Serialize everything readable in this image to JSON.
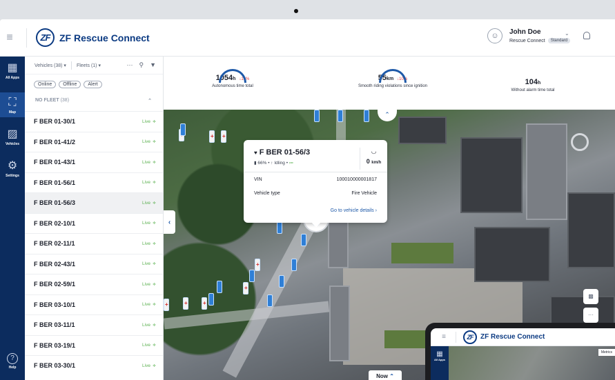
{
  "app": {
    "title": "ZF Rescue Connect",
    "logo_mark": "ZF"
  },
  "user": {
    "name": "John Doe",
    "subscription": "Rescue Connect",
    "plan_badge": "Standard"
  },
  "rail": {
    "items": [
      {
        "label": "All Apps",
        "icon": "grid-icon",
        "glyph": "▦"
      },
      {
        "label": "Map",
        "icon": "map-icon",
        "glyph": "⛶"
      },
      {
        "label": "Vehicles",
        "icon": "car-icon",
        "glyph": "🚘"
      },
      {
        "label": "Settings",
        "icon": "gear-icon",
        "glyph": "⚙"
      }
    ],
    "help_label": "Help",
    "help_glyph": "?"
  },
  "panel": {
    "vehicles_filter": "Vehicles (38) ▾",
    "fleets_filter": "Fleets (1) ▾",
    "status_chips": [
      "Online",
      "Offline",
      "Alert"
    ],
    "fleet_group": "NO FLEET",
    "fleet_count": "(38)",
    "live_label": "Live",
    "vehicles": [
      "F BER 01-30/1",
      "F BER 01-41/2",
      "F BER 01-43/1",
      "F BER 01-56/1",
      "F BER 01-56/3",
      "F BER 02-10/1",
      "F BER 02-11/1",
      "F BER 02-43/1",
      "F BER 02-59/1",
      "F BER 03-10/1",
      "F BER 03-11/1",
      "F BER 03-19/1",
      "F BER 03-30/1"
    ],
    "selected_index": 4
  },
  "metrics": [
    {
      "value": "1054",
      "unit": "h",
      "delta": "↓14%",
      "label": "Autonomous time total"
    },
    {
      "value": "55",
      "unit": "km",
      "delta": "↓10%",
      "label": "Smooth riding violations since ignition"
    },
    {
      "value": "104",
      "unit": "h",
      "delta": "",
      "label": "Without alarm time total"
    }
  ],
  "popup": {
    "title": "F BER 01-56/3",
    "battery": "66%",
    "status": "Idling",
    "speed_value": "0",
    "speed_unit": "km/h",
    "vin_label": "VIN",
    "vin_value": "100010000001817",
    "type_label": "Vehicle type",
    "type_value": "Fire Vehicle",
    "details_link": "Go to vehicle details"
  },
  "map": {
    "now_label": "Now"
  },
  "tablet": {
    "title": "ZF Rescue Connect",
    "rail_label": "All Apps",
    "metrics_tag": "Metrics"
  },
  "colors": {
    "brand": "#0b3a82",
    "rail": "#0c2c5e",
    "accent": "#1e59a8",
    "live": "#5ab04f",
    "alert": "#e03a3a"
  }
}
